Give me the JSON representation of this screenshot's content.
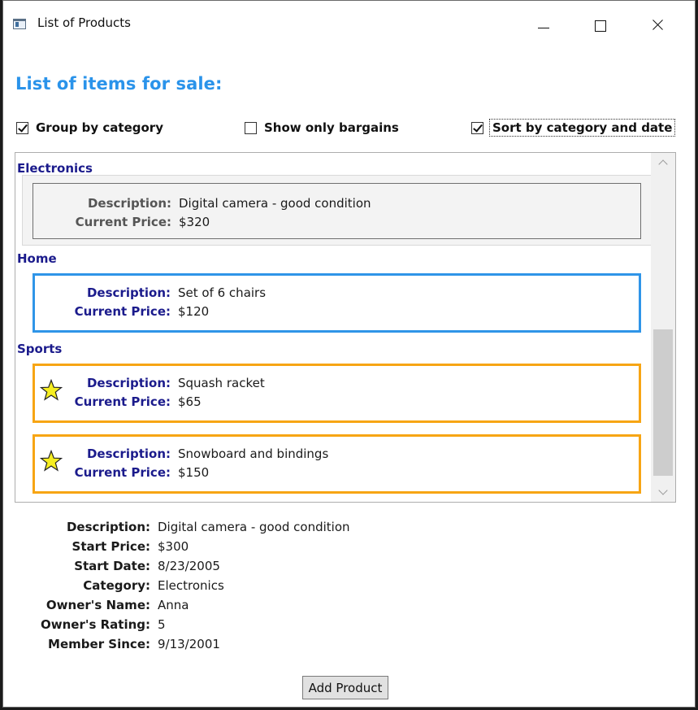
{
  "window": {
    "title": "List of Products"
  },
  "heading": "List of items for sale:",
  "options": {
    "group_by_category": {
      "label": "Group by category",
      "checked": true
    },
    "show_only_bargains": {
      "label": "Show only bargains",
      "checked": false
    },
    "sort_by_category_date": {
      "label": "Sort by category and date",
      "checked": true
    }
  },
  "labels": {
    "description": "Description:",
    "current_price": "Current Price:"
  },
  "groups": [
    {
      "name": "Electronics",
      "items": [
        {
          "description": "Digital camera - good condition",
          "price": "$320",
          "state": "selected"
        }
      ]
    },
    {
      "name": "Home",
      "items": [
        {
          "description": "Set of 6 chairs",
          "price": "$120",
          "state": "normal"
        }
      ]
    },
    {
      "name": "Sports",
      "items": [
        {
          "description": "Squash racket",
          "price": "$65",
          "state": "bargain"
        },
        {
          "description": "Snowboard and bindings",
          "price": "$150",
          "state": "bargain"
        }
      ]
    }
  ],
  "details": {
    "rows": [
      {
        "label": "Description:",
        "value": "Digital camera - good condition"
      },
      {
        "label": "Start Price:",
        "value": "$300"
      },
      {
        "label": "Start Date:",
        "value": "8/23/2005"
      },
      {
        "label": "Category:",
        "value": "Electronics"
      },
      {
        "label": "Owner's Name:",
        "value": "Anna"
      },
      {
        "label": "Owner's Rating:",
        "value": "5"
      },
      {
        "label": "Member Since:",
        "value": "9/13/2001"
      }
    ]
  },
  "buttons": {
    "add_product": "Add Product"
  },
  "colors": {
    "heading": "#2a93ea",
    "bargain_border": "#f7a514",
    "home_border": "#2f95e8",
    "group_header": "#1b1b8c",
    "star_fill": "#f6ee21"
  },
  "icons": {
    "bargain": "star-icon"
  }
}
